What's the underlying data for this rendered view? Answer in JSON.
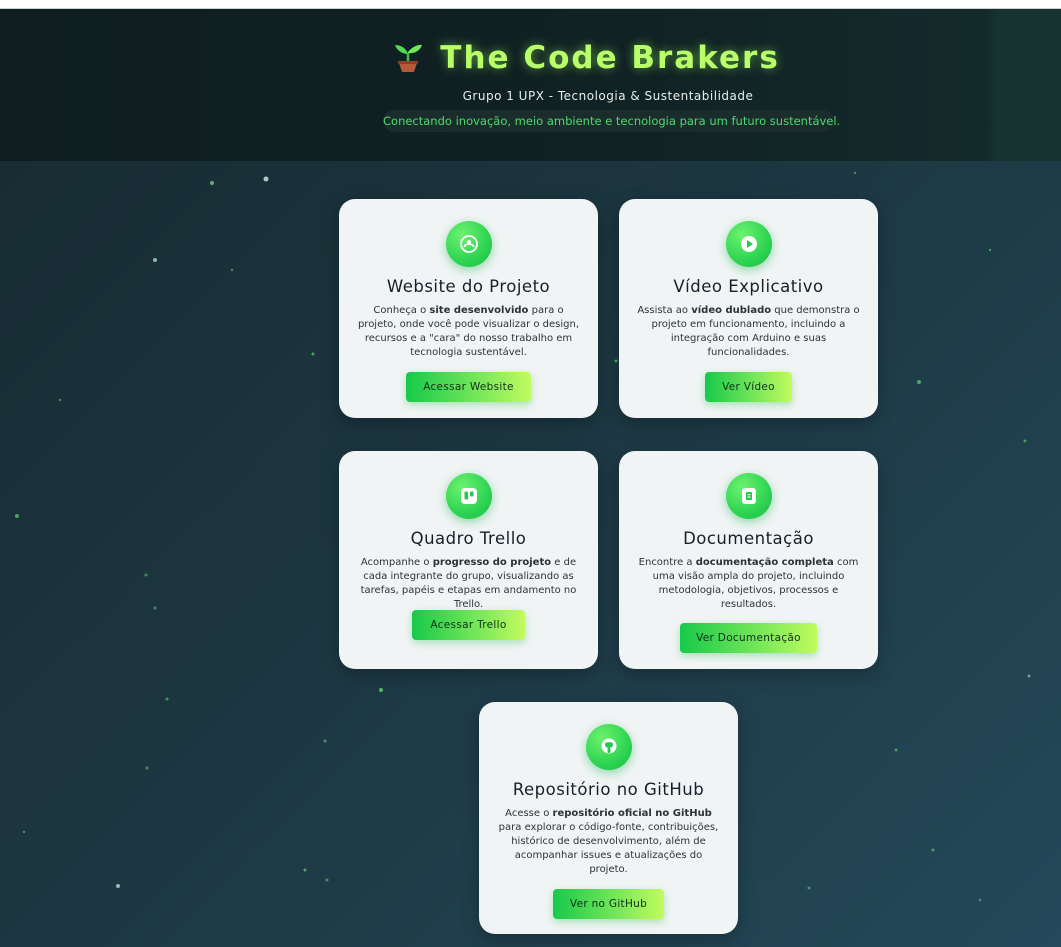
{
  "header": {
    "title": "The Code Brakers",
    "subtitle": "Grupo 1 UPX - Tecnologia & Sustentabilidade",
    "tagline": "Conectando inovação, meio ambiente e tecnologia para um futuro sustentável."
  },
  "cards": [
    {
      "icon": "globe-icon",
      "title": "Website do Projeto",
      "desc_a": "Conheça o ",
      "desc_b": "site desenvolvido",
      "desc_c": " para o projeto, onde você pode visualizar o design, recursos e a \"cara\" do nosso trabalho em tecnologia sustentável.",
      "button": "Acessar Website"
    },
    {
      "icon": "play-icon",
      "title": "Vídeo Explicativo",
      "desc_a": "Assista ao ",
      "desc_b": "vídeo dublado",
      "desc_c": " que demonstra o projeto em funcionamento, incluindo a integração com Arduino e suas funcionalidades.",
      "button": "Ver Vídeo"
    },
    {
      "icon": "trello-icon",
      "title": "Quadro Trello",
      "desc_a": "Acompanhe o ",
      "desc_b": "progresso do projeto",
      "desc_c": " e de cada integrante do grupo, visualizando as tarefas, papéis e etapas em andamento no Trello.",
      "button": "Acessar Trello"
    },
    {
      "icon": "document-icon",
      "title": "Documentação",
      "desc_a": "Encontre a ",
      "desc_b": "documentação completa",
      "desc_c": " com uma visão ampla do projeto, incluindo metodologia, objetivos, processos e resultados.",
      "button": "Ver Documentação"
    },
    {
      "icon": "github-icon",
      "title": "Repositório no GitHub",
      "desc_a": "Acesse o ",
      "desc_b": "repositório oficial no GitHub",
      "desc_c": " para explorar o código-fonte, contribuições, histórico de desenvolvimento, além de acompanhar issues e atualizações do projeto.",
      "button": "Ver no GitHub"
    }
  ],
  "colors": {
    "accent": "#b8ff6a",
    "button_start": "#17c94a",
    "button_end": "#c2fb5e",
    "tagline_text": "#4bdc6a"
  }
}
